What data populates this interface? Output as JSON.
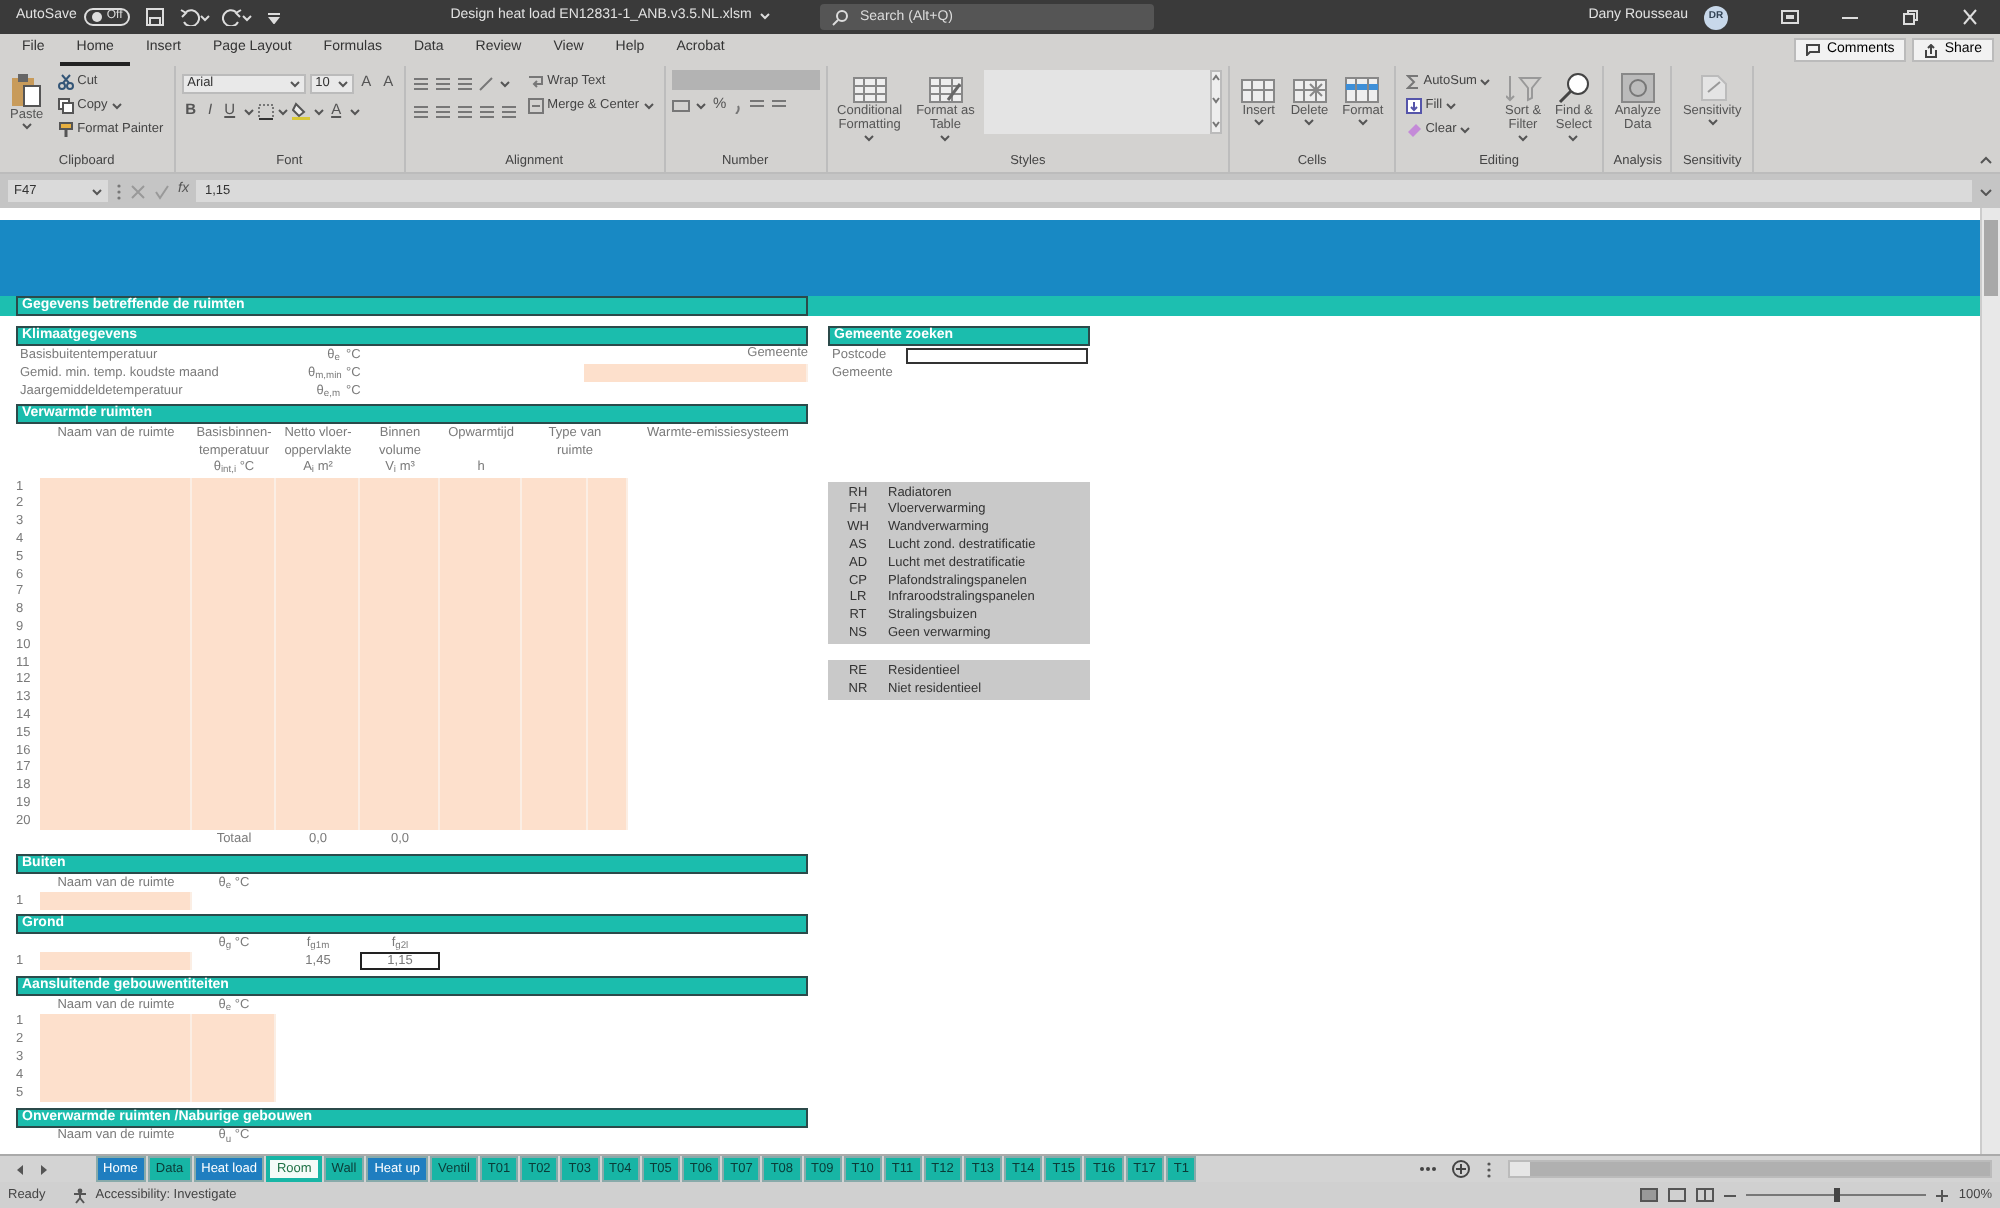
{
  "title_bar": {
    "autosave_label": "AutoSave",
    "autosave": {
      "state": "Off",
      "on": false
    },
    "filename": "Design heat load EN12831-1_ANB.v3.5.NL.xlsm",
    "search": {
      "placeholder": "Search (Alt+Q)"
    },
    "user": "Dany Rousseau",
    "avatar": "DR"
  },
  "menu_tabs": [
    {
      "label": "File",
      "selected": false
    },
    {
      "label": "Home",
      "selected": true
    },
    {
      "label": "Insert",
      "selected": false
    },
    {
      "label": "Page Layout",
      "selected": false
    },
    {
      "label": "Formulas",
      "selected": false
    },
    {
      "label": "Data",
      "selected": false
    },
    {
      "label": "Review",
      "selected": false
    },
    {
      "label": "View",
      "selected": false
    },
    {
      "label": "Help",
      "selected": false
    },
    {
      "label": "Acrobat",
      "selected": false
    }
  ],
  "header_buttons": [
    "Comments",
    "Share"
  ],
  "ribbon": {
    "groups": [
      {
        "label": "Clipboard",
        "items": [
          "Paste",
          "Cut",
          "Copy",
          "Format Painter"
        ]
      },
      {
        "label": "Font",
        "items": [
          "Arial",
          "10",
          "A",
          "A",
          "B",
          "I",
          "U",
          "A"
        ]
      },
      {
        "label": "Alignment",
        "items": [
          "Wrap Text",
          "Merge & Center"
        ]
      },
      {
        "label": "Number",
        "items": [
          "%"
        ]
      },
      {
        "label": "Styles",
        "items": [
          "Conditional\nFormatting",
          "Format as\nTable"
        ]
      },
      {
        "label": "Cells",
        "items": [
          "Insert",
          "Delete",
          "Format"
        ]
      },
      {
        "label": "Editing",
        "items": [
          "AutoSum",
          "Fill",
          "Clear",
          "Sort &\nFilter",
          "Find &\nSelect"
        ]
      },
      {
        "label": "Analysis",
        "items": [
          "Analyze\nData"
        ]
      },
      {
        "label": "Sensitivity",
        "items": [
          "Sensitivity"
        ]
      }
    ]
  },
  "formula_bar": {
    "cell": "F47",
    "function_label": "fx",
    "value": "1,15"
  },
  "sheet": {
    "main_title": "Gegevens betreffende de ruimten",
    "climate": {
      "title": "Klimaatgegevens",
      "rows": [
        {
          "label": "Basisbuitentemperatuur",
          "symbol": "θ$_{e}$",
          "unit": "°C"
        },
        {
          "label": "Gemid. min. temp. koudste maand",
          "symbol": "θ$_{m,min}$",
          "unit": "°C"
        },
        {
          "label": "Jaargemiddeldetemperatuur",
          "symbol": "θ$_{e,m}$",
          "unit": "°C"
        }
      ],
      "municipality_label": "Gemeente"
    },
    "heated_rooms": {
      "title": "Verwarmde ruimten",
      "columns": [
        [
          "Naam van de ruimte"
        ],
        [
          "Basisbinnen-",
          "temperatuur",
          "θ$_{int,i}$   °C"
        ],
        [
          "Netto vloer-",
          "oppervlakte",
          "A$_{i}$   m²"
        ],
        [
          "Binnen",
          "volume",
          "V$_{i}$   m³"
        ],
        [
          "Opwarmtijd",
          "",
          "h"
        ],
        [
          "Type van",
          "ruimte"
        ],
        [
          "Warmte-emissiesysteem"
        ]
      ],
      "rows": [
        "1",
        "2",
        "3",
        "4",
        "5",
        "6",
        "7",
        "8",
        "9",
        "10",
        "11",
        "12",
        "13",
        "14",
        "15",
        "16",
        "17",
        "18",
        "19",
        "20"
      ],
      "total_label": "Totaal",
      "totals": [
        "0,0",
        "0,0"
      ]
    },
    "outside": {
      "title": "Buiten",
      "header": [
        "Naam van de ruimte",
        "θ$_{e}$   °C"
      ],
      "rows": [
        "1"
      ]
    },
    "ground": {
      "title": "Grond",
      "header": [
        "θ$_{g}$   °C",
        "f$_{g1m}$",
        "f$_{g2l}$"
      ],
      "rows": [
        {
          "number": "1",
          "values": [
            {
              "text": "1,45",
              "selected": false
            },
            {
              "text": "1,15",
              "selected": true
            }
          ]
        }
      ]
    },
    "adjacent": {
      "title": "Aansluitende gebouwentiteiten",
      "header": [
        "Naam van de ruimte",
        "θ$_{e}$   °C"
      ],
      "rows": [
        "1",
        "2",
        "3",
        "4",
        "5"
      ]
    },
    "unheated": {
      "title": "Onverwarmde ruimten /Naburige gebouwen",
      "header": [
        "Naam van de ruimte",
        "θ$_{u}$   °C"
      ]
    },
    "search_panel": {
      "title": "Gemeente zoeken",
      "fields": [
        {
          "label": "Postcode",
          "kind": "input"
        },
        {
          "label": "Gemeente",
          "kind": "text"
        }
      ]
    },
    "emission_codes": [
      {
        "code": "RH",
        "label": "Radiatoren"
      },
      {
        "code": "FH",
        "label": "Vloerverwarming"
      },
      {
        "code": "WH",
        "label": "Wandverwarming"
      },
      {
        "code": "AS",
        "label": "Lucht zond. destratificatie"
      },
      {
        "code": "AD",
        "label": "Lucht met destratificatie"
      },
      {
        "code": "CP",
        "label": "Plafondstralingspanelen"
      },
      {
        "code": "LR",
        "label": "Infraroodstralingspanelen"
      },
      {
        "code": "RT",
        "label": "Stralingsbuizen"
      },
      {
        "code": "NS",
        "label": "Geen verwarming"
      }
    ],
    "room_types": [
      {
        "code": "RE",
        "label": "Residentieel"
      },
      {
        "code": "NR",
        "label": "Niet residentieel"
      }
    ]
  },
  "sheet_tabs": [
    {
      "label": "Home",
      "color": "#1f7ec0",
      "selected": false
    },
    {
      "label": "Data",
      "color": "#17b5a5",
      "selected": false
    },
    {
      "label": "Heat load",
      "color": "#1f7ec0",
      "selected": false
    },
    {
      "label": "Room",
      "color": "#17b5a5",
      "selected": true
    },
    {
      "label": "Wall",
      "color": "#17b5a5",
      "selected": false
    },
    {
      "label": "Heat up",
      "color": "#1f7ec0",
      "selected": false
    },
    {
      "label": "Ventil",
      "color": "#17b5a5",
      "selected": false
    },
    {
      "label": "T01",
      "color": "#17b5a5",
      "selected": false
    },
    {
      "label": "T02",
      "color": "#17b5a5",
      "selected": false
    },
    {
      "label": "T03",
      "color": "#17b5a5",
      "selected": false
    },
    {
      "label": "T04",
      "color": "#17b5a5",
      "selected": false
    },
    {
      "label": "T05",
      "color": "#17b5a5",
      "selected": false
    },
    {
      "label": "T06",
      "color": "#17b5a5",
      "selected": false
    },
    {
      "label": "T07",
      "color": "#17b5a5",
      "selected": false
    },
    {
      "label": "T08",
      "color": "#17b5a5",
      "selected": false
    },
    {
      "label": "T09",
      "color": "#17b5a5",
      "selected": false
    },
    {
      "label": "T10",
      "color": "#17b5a5",
      "selected": false
    },
    {
      "label": "T11",
      "color": "#17b5a5",
      "selected": false
    },
    {
      "label": "T12",
      "color": "#17b5a5",
      "selected": false
    },
    {
      "label": "T13",
      "color": "#17b5a5",
      "selected": false
    },
    {
      "label": "T14",
      "color": "#17b5a5",
      "selected": false
    },
    {
      "label": "T15",
      "color": "#17b5a5",
      "selected": false
    },
    {
      "label": "T16",
      "color": "#17b5a5",
      "selected": false
    },
    {
      "label": "T17",
      "color": "#17b5a5",
      "selected": false
    },
    {
      "label": "T1",
      "color": "#17b5a5",
      "selected": false
    }
  ],
  "status_bar": {
    "state": "Ready",
    "accessibility": "Accessibility: Investigate",
    "zoom": {
      "level": 0.5,
      "reading": "100%"
    }
  }
}
